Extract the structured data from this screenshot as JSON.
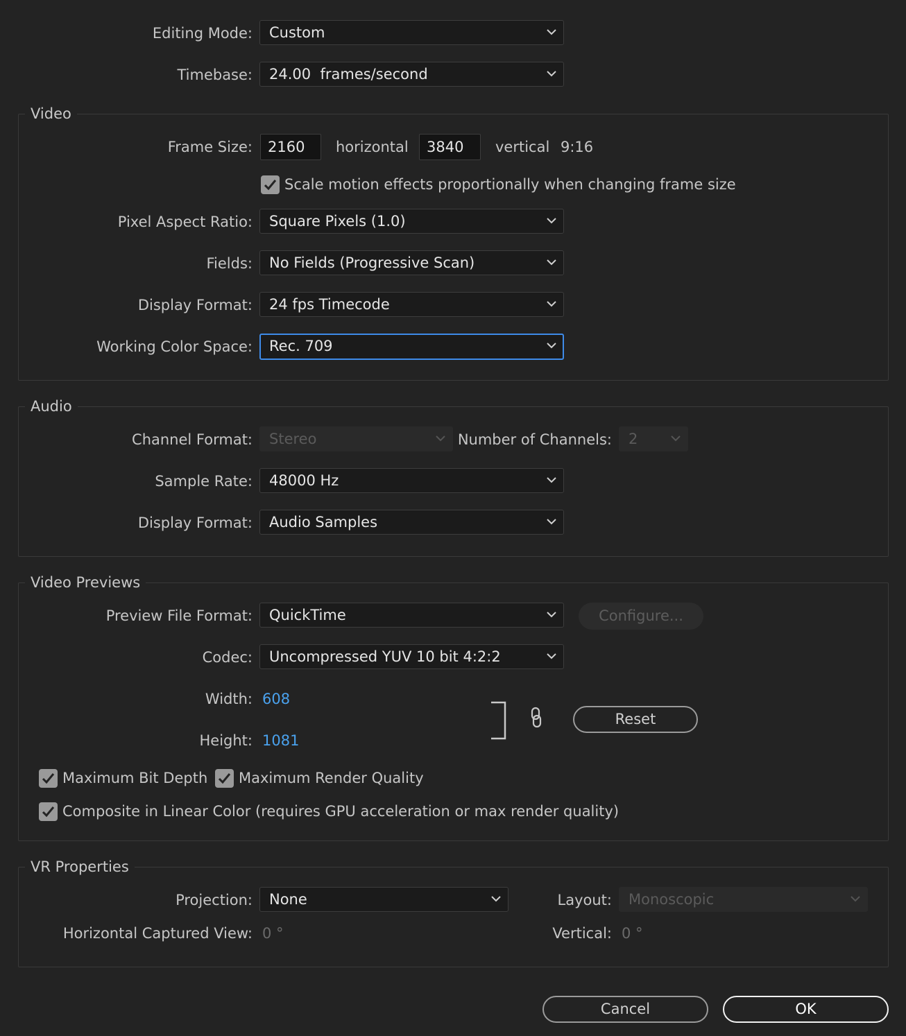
{
  "general": {
    "editing_mode_label": "Editing Mode:",
    "editing_mode_value": "Custom",
    "timebase_label": "Timebase:",
    "timebase_value": "24.00  frames/second"
  },
  "video": {
    "title": "Video",
    "frame_size_label": "Frame Size:",
    "frame_width": "2160",
    "horizontal_text": "horizontal",
    "frame_height": "3840",
    "vertical_text": "vertical",
    "aspect": "9:16",
    "scale_motion_label": "Scale motion effects proportionally when changing frame size",
    "scale_motion_checked": true,
    "pixel_aspect_label": "Pixel Aspect Ratio:",
    "pixel_aspect_value": "Square Pixels (1.0)",
    "fields_label": "Fields:",
    "fields_value": "No Fields (Progressive Scan)",
    "display_format_label": "Display Format:",
    "display_format_value": "24 fps Timecode",
    "color_space_label": "Working Color Space:",
    "color_space_value": "Rec. 709"
  },
  "audio": {
    "title": "Audio",
    "channel_format_label": "Channel Format:",
    "channel_format_value": "Stereo",
    "num_channels_label": "Number of Channels:",
    "num_channels_value": "2",
    "sample_rate_label": "Sample Rate:",
    "sample_rate_value": "48000 Hz",
    "display_format_label": "Display Format:",
    "display_format_value": "Audio Samples"
  },
  "previews": {
    "title": "Video Previews",
    "file_format_label": "Preview File Format:",
    "file_format_value": "QuickTime",
    "configure_label": "Configure...",
    "codec_label": "Codec:",
    "codec_value": "Uncompressed YUV 10 bit 4:2:2",
    "width_label": "Width:",
    "width_value": "608",
    "height_label": "Height:",
    "height_value": "1081",
    "reset_label": "Reset",
    "max_bit_depth_label": "Maximum Bit Depth",
    "max_render_quality_label": "Maximum Render Quality",
    "composite_linear_label": "Composite in Linear Color (requires GPU acceleration or max render quality)"
  },
  "vr": {
    "title": "VR Properties",
    "projection_label": "Projection:",
    "projection_value": "None",
    "layout_label": "Layout:",
    "layout_value": "Monoscopic",
    "h_captured_label": "Horizontal Captured View:",
    "h_captured_value": "0 °",
    "vertical_label": "Vertical:",
    "vertical_value": "0 °"
  },
  "footer": {
    "cancel_label": "Cancel",
    "ok_label": "OK"
  },
  "colors": {
    "background": "#232323",
    "accent_blue": "#3e8be9",
    "link_blue": "#4aa2ee"
  }
}
